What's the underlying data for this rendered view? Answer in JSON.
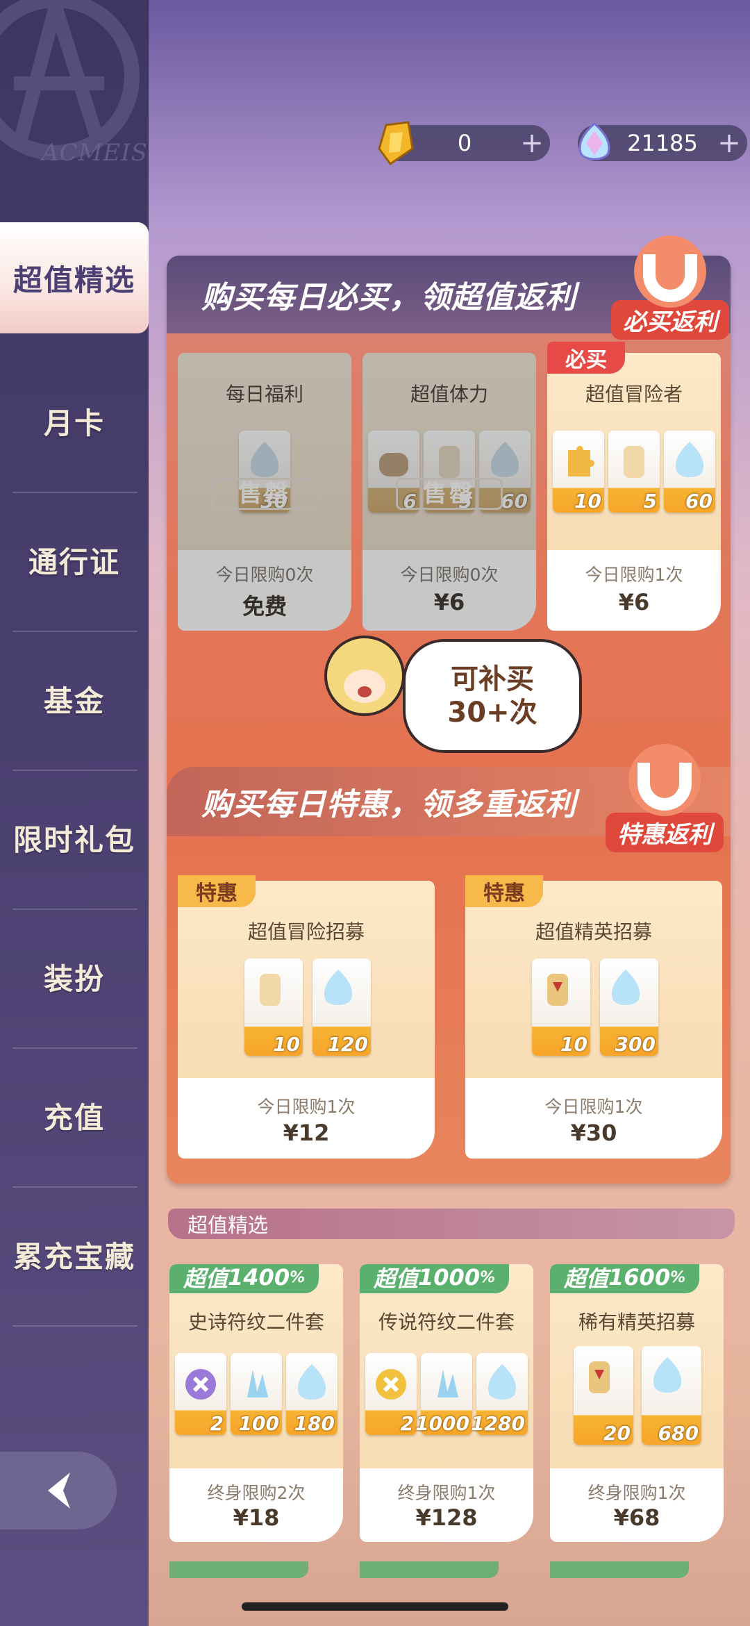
{
  "currency": {
    "gold": {
      "value": "0",
      "plus": "+"
    },
    "gem": {
      "value": "21185",
      "plus": "+"
    }
  },
  "sidebar": {
    "logo": "ACMEIS",
    "items": [
      {
        "label": "超值精选"
      },
      {
        "label": "月卡"
      },
      {
        "label": "通行证"
      },
      {
        "label": "基金"
      },
      {
        "label": "限时礼包"
      },
      {
        "label": "装扮"
      },
      {
        "label": "充值"
      },
      {
        "label": "累充宝藏"
      }
    ]
  },
  "mustbuy": {
    "banner": "购买每日必买，领超值返利",
    "badge": "必买返利",
    "cards": [
      {
        "title": "每日福利",
        "items": [
          "30"
        ],
        "limit": "今日限购0次",
        "price": "免费",
        "sold": "售罄"
      },
      {
        "title": "超值体力",
        "items": [
          "6",
          "5",
          "60"
        ],
        "limit": "今日限购0次",
        "price": "¥6",
        "sold": "售罄"
      },
      {
        "title": "超值冒险者",
        "tag": "必买",
        "items": [
          "10",
          "5",
          "60"
        ],
        "limit": "今日限购1次",
        "price": "¥6"
      }
    ],
    "bubble_line1": "可补买",
    "bubble_line2": "30+次"
  },
  "special": {
    "banner": "购买每日特惠，领多重返利",
    "badge": "特惠返利",
    "cards": [
      {
        "tag": "特惠",
        "title": "超值冒险招募",
        "items": [
          "10",
          "120"
        ],
        "limit": "今日限购1次",
        "price": "¥12"
      },
      {
        "tag": "特惠",
        "title": "超值精英招募",
        "items": [
          "10",
          "300"
        ],
        "limit": "今日限购1次",
        "price": "¥30"
      }
    ]
  },
  "value_section": {
    "label": "超值精选",
    "cards": [
      {
        "tag": "超值",
        "pct": "1400",
        "pct_unit": "%",
        "title": "史诗符纹二件套",
        "items": [
          "2",
          "100",
          "180"
        ],
        "limit": "终身限购2次",
        "price": "¥18"
      },
      {
        "tag": "超值",
        "pct": "1000",
        "pct_unit": "%",
        "title": "传说符纹二件套",
        "items": [
          "2",
          "1000",
          "1280"
        ],
        "limit": "终身限购1次",
        "price": "¥128"
      },
      {
        "tag": "超值",
        "pct": "1600",
        "pct_unit": "%",
        "title": "稀有精英招募",
        "items": [
          "20",
          "680"
        ],
        "limit": "终身限购1次",
        "price": "¥68"
      }
    ]
  },
  "colors": {
    "sidebar": "#433a68",
    "panel": "#e2775a",
    "accent": "#f6b94a",
    "green": "#5bb06d"
  }
}
